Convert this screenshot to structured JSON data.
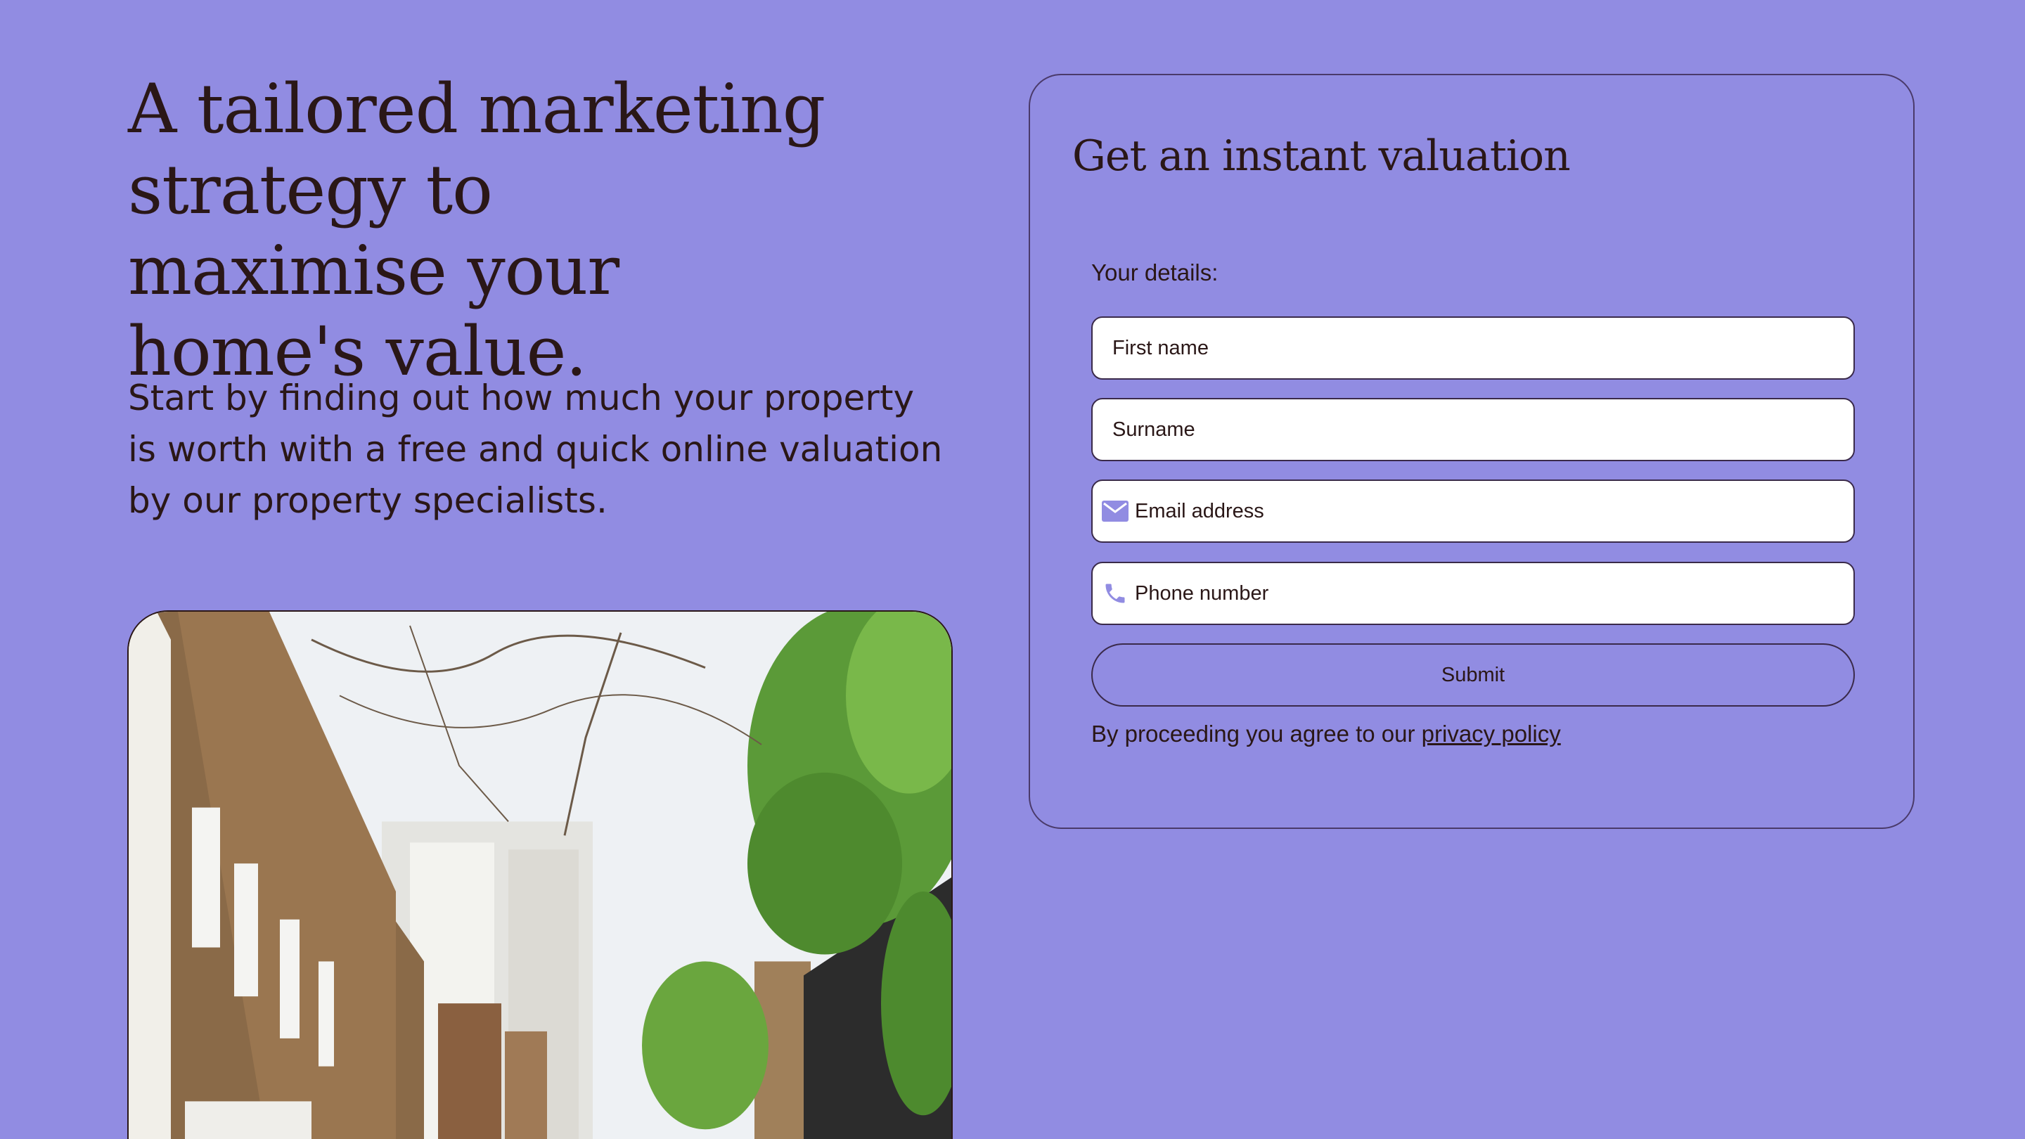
{
  "hero": {
    "headline": "A tailored marketing strategy to maximise your home's value.",
    "lede": "Start by finding out how much your property is worth with a free and quick online valuation by our property specialists."
  },
  "form": {
    "title": "Get an instant valuation",
    "details_label": "Your details:",
    "fields": {
      "first_name": {
        "placeholder": "First name",
        "value": ""
      },
      "surname": {
        "placeholder": "Surname",
        "value": ""
      },
      "email": {
        "placeholder": "Email address",
        "value": "",
        "icon": "envelope-icon"
      },
      "phone": {
        "placeholder": "Phone number",
        "value": "",
        "icon": "phone-icon"
      }
    },
    "submit_label": "Submit",
    "consent_text": "By proceeding you agree to our",
    "privacy_link": "privacy policy"
  },
  "colors": {
    "background": "#918ce2",
    "text": "#2a1717",
    "icon": "#918ce2",
    "field_background": "#ffffff"
  }
}
